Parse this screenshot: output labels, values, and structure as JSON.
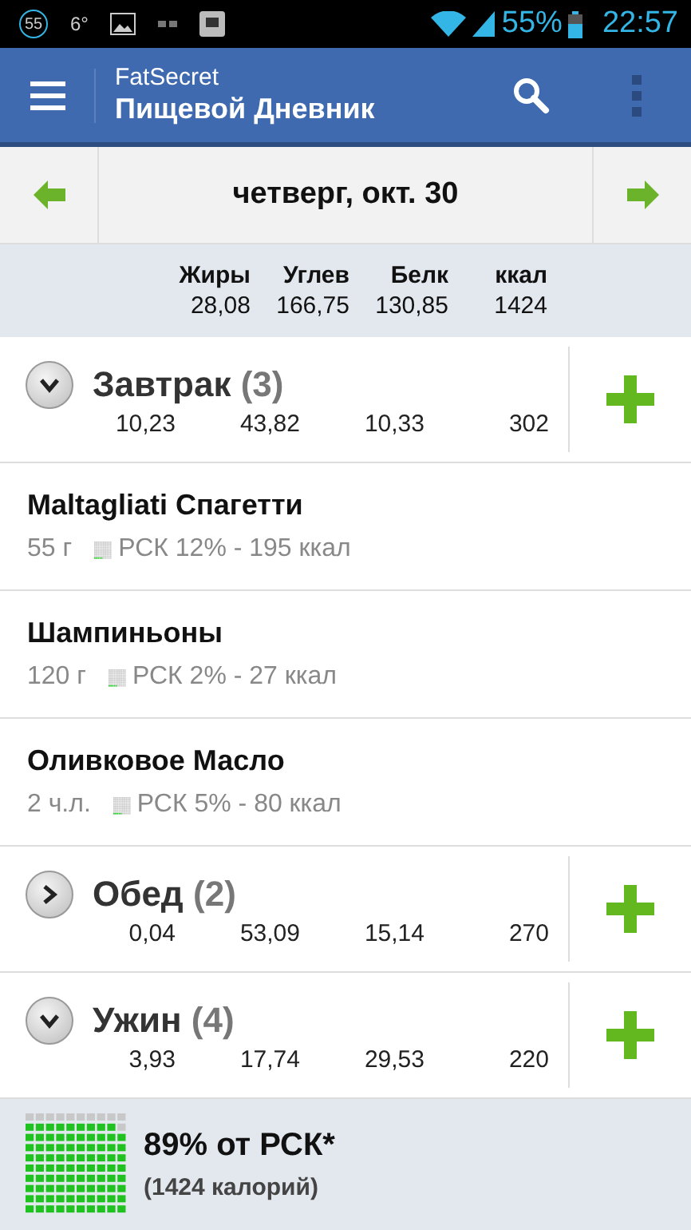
{
  "status_bar": {
    "badge": "55",
    "temperature": "6°",
    "battery_text": "55%",
    "time": "22:57"
  },
  "app_bar": {
    "app_name": "FatSecret",
    "title": "Пищевой Дневник"
  },
  "date_bar": {
    "date": "четверг, окт. 30"
  },
  "totals": {
    "columns": [
      {
        "label": "Жиры",
        "value": "28,08"
      },
      {
        "label": "Углев",
        "value": "166,75"
      },
      {
        "label": "Белк",
        "value": "130,85"
      },
      {
        "label": "ккал",
        "value": "1424"
      }
    ]
  },
  "meals": [
    {
      "name": "Завтрак",
      "count": "(3)",
      "expanded": true,
      "values": [
        "10,23",
        "43,82",
        "10,33",
        "302"
      ],
      "items": [
        {
          "name": "Maltagliati Спагетти",
          "amount": "55 г",
          "info": "РСК 12% - 195 ккал"
        },
        {
          "name": "Шампиньоны",
          "amount": "120 г",
          "info": "РСК 2% - 27 ккал"
        },
        {
          "name": "Оливковое Масло",
          "amount": "2  ч.л.",
          "info": "РСК 5% - 80 ккал"
        }
      ]
    },
    {
      "name": "Обед",
      "count": "(2)",
      "expanded": false,
      "values": [
        "0,04",
        "53,09",
        "15,14",
        "270"
      ]
    },
    {
      "name": "Ужин",
      "count": "(4)",
      "expanded": true,
      "values": [
        "3,93",
        "17,74",
        "29,53",
        "220"
      ]
    }
  ],
  "summary": {
    "title": "89% от РСК*",
    "subtitle": "(1424 калорий)"
  }
}
